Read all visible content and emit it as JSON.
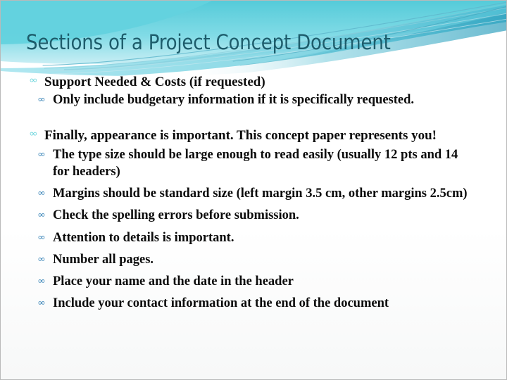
{
  "slide": {
    "title": "Sections of a Project Concept Document",
    "theme": {
      "title_color": "#1d5c6b",
      "accent_cyan": "#6fd6dd",
      "accent_teal": "#3ab6c8",
      "accent_blue": "#3a85b8",
      "band_top": "#5ecfdb",
      "band_bottom": "#a9e6ee",
      "body_text_color": "#0b0b0b",
      "background": "#ffffff"
    },
    "bullet_glyphs": {
      "level1": "∞",
      "level2": "∞"
    },
    "content": [
      {
        "level": 1,
        "align": "plain",
        "text": "Support Needed & Costs (if requested)"
      },
      {
        "level": 2,
        "align": "justify",
        "text": "Only include budgetary information if it is specifically requested."
      },
      {
        "level": 1,
        "align": "plain",
        "text": "Finally, appearance is important. This concept paper represents you!"
      },
      {
        "level": 2,
        "align": "plain",
        "text": "The type size should be large enough to read easily (usually 12 pts and 14 for headers)"
      },
      {
        "level": 2,
        "align": "justify",
        "text": "Margins should be standard size (left margin 3.5 cm, other margins 2.5cm)"
      },
      {
        "level": 2,
        "align": "plain",
        "text": "Check the spelling errors before submission."
      },
      {
        "level": 2,
        "align": "plain",
        "text": "Attention to details is important."
      },
      {
        "level": 2,
        "align": "plain",
        "text": "Number all pages."
      },
      {
        "level": 2,
        "align": "plain",
        "text": "Place your name and the date in the header"
      },
      {
        "level": 2,
        "align": "plain",
        "text": "Include your contact information at the end of the document"
      }
    ]
  }
}
